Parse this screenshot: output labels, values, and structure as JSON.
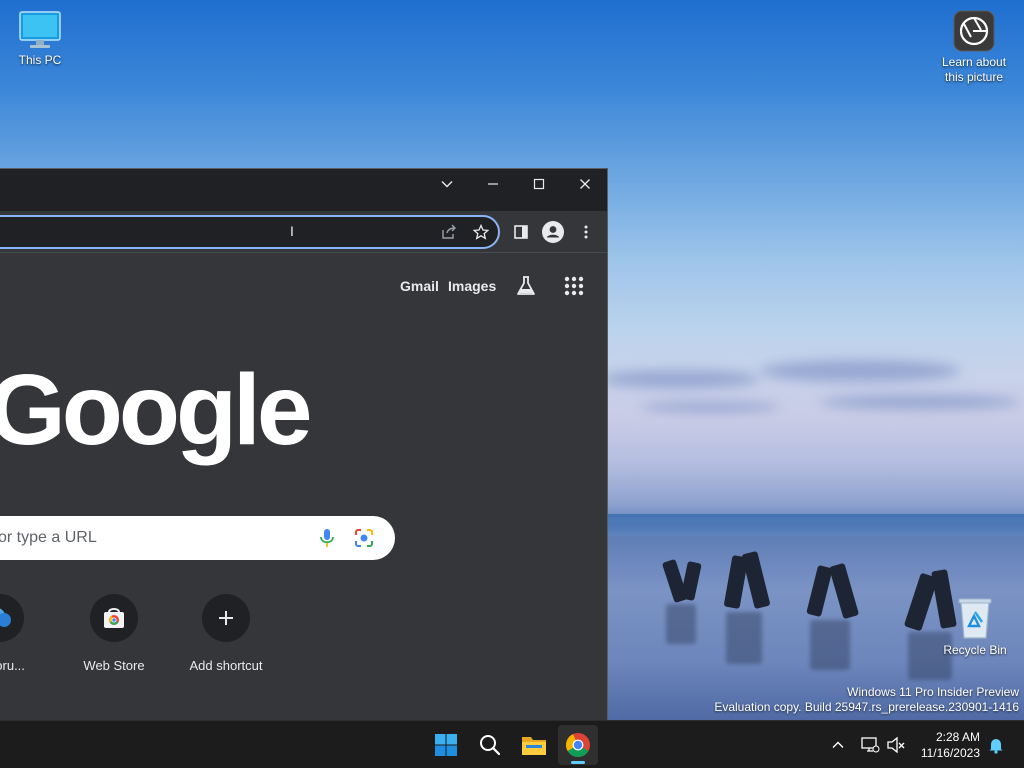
{
  "desktop": {
    "icons": [
      {
        "label": "This PC",
        "icon": "monitor-icon"
      },
      {
        "label": "Learn about this picture",
        "icon": "camera-info-icon"
      },
      {
        "label": "Recycle Bin",
        "icon": "recycle-bin-icon"
      }
    ],
    "watermark": {
      "line1": "Windows 11 Pro Insider Preview",
      "line2": "Evaluation copy. Build 25947.rs_prerelease.230901-1416"
    }
  },
  "browser": {
    "window_controls": {
      "tab_search": "chevron-down-icon",
      "minimize": "minimize-icon",
      "maximize": "maximize-icon",
      "close": "close-icon"
    },
    "toolbar_icons": [
      "share-icon",
      "star-icon",
      "side-panel-icon",
      "profile-icon",
      "more-vert-icon"
    ],
    "ntp": {
      "links": {
        "gmail": "Gmail",
        "images": "Images"
      },
      "logo": "Google",
      "search_placeholder": "or type a URL",
      "shortcuts": [
        {
          "label": "E Foru..."
        },
        {
          "label": "Web Store"
        },
        {
          "label": "Add shortcut"
        }
      ]
    }
  },
  "taskbar": {
    "apps": [
      "start-icon",
      "search-icon",
      "file-explorer-icon",
      "chrome-icon"
    ],
    "clock": {
      "time": "2:28 AM",
      "date": "11/16/2023"
    }
  },
  "colors": {
    "accent": "#8ab4f8",
    "ntp_bg": "#35363a",
    "titlebar": "#202124",
    "taskbar": "#1c1c1c",
    "running_indicator": "#60cdff"
  }
}
